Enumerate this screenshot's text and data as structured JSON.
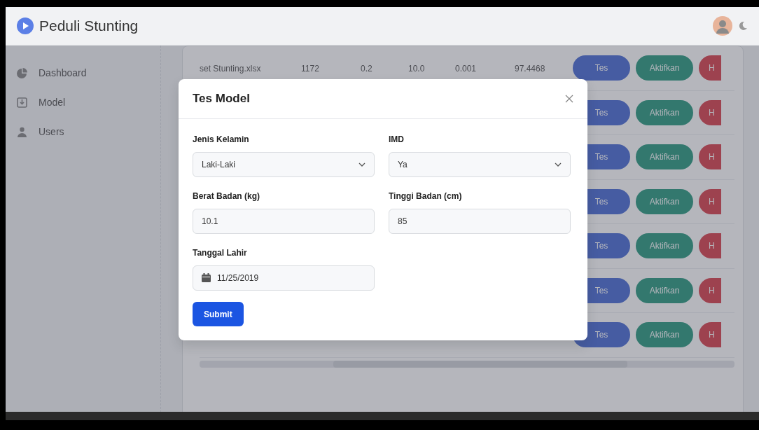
{
  "app": {
    "title": "Peduli Stunting"
  },
  "sidebar": {
    "items": [
      {
        "label": "Dashboard"
      },
      {
        "label": "Model"
      },
      {
        "label": "Users"
      }
    ]
  },
  "table": {
    "rows": [
      {
        "cells": [
          "set Stunting.xlsx",
          "1172",
          "0.2",
          "10.0",
          "0.001",
          "97.4468"
        ],
        "actions": [
          "Tes",
          "Aktifkan",
          "H"
        ]
      },
      {
        "actions": [
          "Tes",
          "Aktifkan",
          "H"
        ]
      },
      {
        "actions": [
          "Tes",
          "Aktifkan",
          "H"
        ]
      },
      {
        "actions": [
          "Tes",
          "Aktifkan",
          "H"
        ]
      },
      {
        "actions": [
          "Tes",
          "Aktifkan",
          "H"
        ]
      },
      {
        "actions": [
          "Tes",
          "Aktifkan",
          "H"
        ]
      },
      {
        "actions": [
          "Tes",
          "Aktifkan",
          "H"
        ]
      }
    ]
  },
  "modal": {
    "title": "Tes Model",
    "fields": [
      {
        "label": "Jenis Kelamin",
        "kind": "select",
        "value": "Laki-Laki"
      },
      {
        "label": "IMD",
        "kind": "select",
        "value": "Ya"
      },
      {
        "label": "Berat Badan (kg)",
        "kind": "input",
        "value": "10.1"
      },
      {
        "label": "Tinggi Badan (cm)",
        "kind": "input",
        "value": "85"
      },
      {
        "label": "Tanggal Lahir",
        "kind": "date",
        "value": "11/25/2019"
      }
    ],
    "submit": "Submit"
  }
}
